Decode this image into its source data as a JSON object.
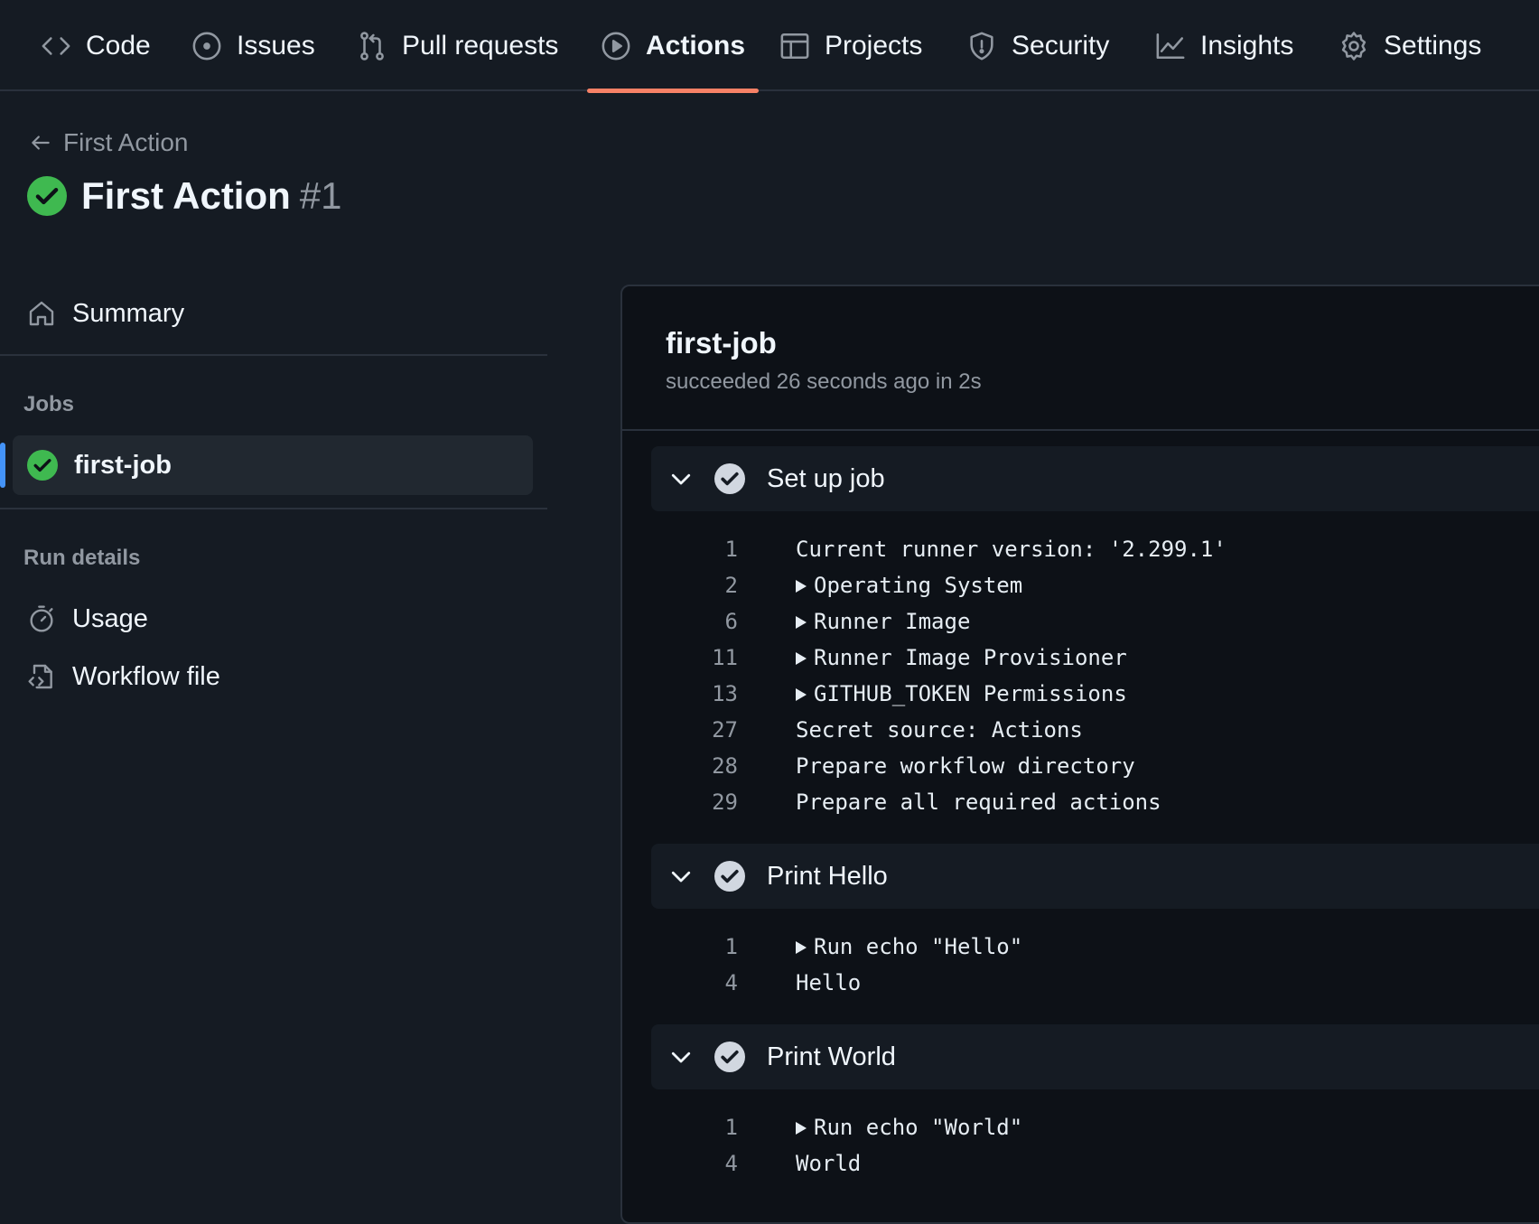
{
  "nav": {
    "tabs": [
      {
        "label": "Code",
        "icon": "code-icon"
      },
      {
        "label": "Issues",
        "icon": "issue-icon"
      },
      {
        "label": "Pull requests",
        "icon": "pull-request-icon"
      },
      {
        "label": "Actions",
        "icon": "play-icon",
        "active": true
      },
      {
        "label": "Projects",
        "icon": "table-icon"
      },
      {
        "label": "Security",
        "icon": "shield-icon"
      },
      {
        "label": "Insights",
        "icon": "graph-icon"
      },
      {
        "label": "Settings",
        "icon": "gear-icon"
      }
    ]
  },
  "header": {
    "back_label": "First Action",
    "run_title": "First Action",
    "run_number": "#1"
  },
  "sidebar": {
    "summary_label": "Summary",
    "jobs_heading": "Jobs",
    "job_label": "first-job",
    "run_details_heading": "Run details",
    "usage_label": "Usage",
    "workflow_file_label": "Workflow file"
  },
  "job": {
    "title": "first-job",
    "status": "succeeded 26 seconds ago in 2s",
    "steps": [
      {
        "label": "Set up job",
        "lines": [
          {
            "n": "1",
            "text": "Current runner version: '2.299.1'",
            "expandable": false
          },
          {
            "n": "2",
            "text": "Operating System",
            "expandable": true
          },
          {
            "n": "6",
            "text": "Runner Image",
            "expandable": true
          },
          {
            "n": "11",
            "text": "Runner Image Provisioner",
            "expandable": true
          },
          {
            "n": "13",
            "text": "GITHUB_TOKEN Permissions",
            "expandable": true
          },
          {
            "n": "27",
            "text": "Secret source: Actions",
            "expandable": false
          },
          {
            "n": "28",
            "text": "Prepare workflow directory",
            "expandable": false
          },
          {
            "n": "29",
            "text": "Prepare all required actions",
            "expandable": false
          }
        ]
      },
      {
        "label": "Print Hello",
        "lines": [
          {
            "n": "1",
            "text": "Run echo \"Hello\"",
            "expandable": true
          },
          {
            "n": "4",
            "text": "Hello",
            "expandable": false
          }
        ]
      },
      {
        "label": "Print World",
        "lines": [
          {
            "n": "1",
            "text": "Run echo \"World\"",
            "expandable": true
          },
          {
            "n": "4",
            "text": "World",
            "expandable": false
          }
        ]
      }
    ]
  },
  "colors": {
    "accent": "#f78166",
    "success": "#3fb950",
    "link": "#4493f8"
  }
}
